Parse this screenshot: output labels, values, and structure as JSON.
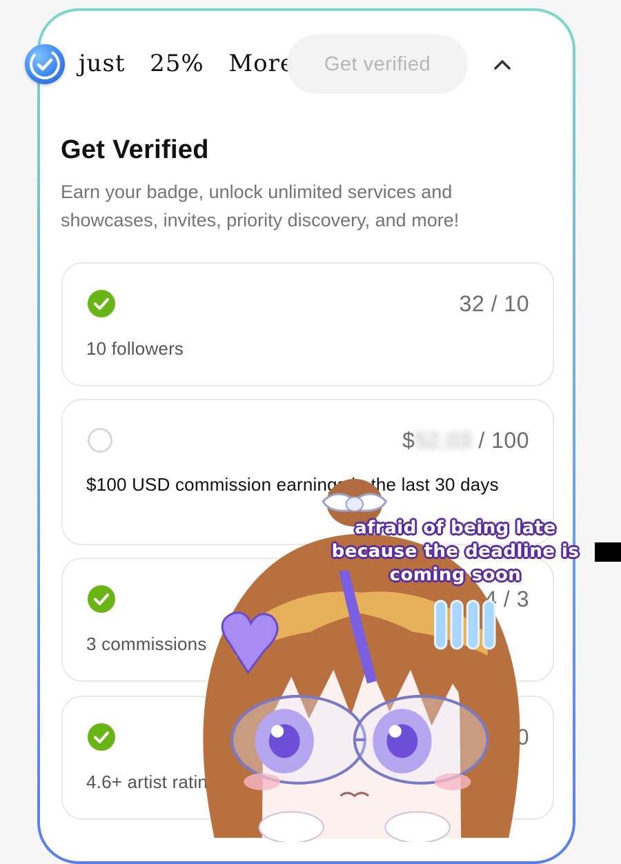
{
  "header": {
    "progress_text": "just  25%  More!",
    "get_verified_button": "Get verified",
    "icons": {
      "verified": "verified-check-badge-icon",
      "collapse": "chevron-up-icon"
    }
  },
  "title": "Get Verified",
  "description": "Earn your badge, unlock unlimited services and showcases, invites, priority discovery, and more!",
  "requirements": [
    {
      "done": true,
      "count": "32 / 10",
      "label": "10 followers"
    },
    {
      "done": false,
      "count_prefix": "$",
      "count_hidden": "52.03",
      "count_suffix": " / 100",
      "label": "$100 USD commission earnings in the last 30 days"
    },
    {
      "done": true,
      "count": "4 / 3",
      "label": "3 commissions"
    },
    {
      "done": true,
      "count": "5.0",
      "label": "4.6+ artist rating"
    }
  ],
  "sticker": {
    "caption_lines": [
      "afraid of being late",
      "because the deadline is",
      "coming soon"
    ]
  },
  "colors": {
    "check_green": "#6ab516",
    "border_gradient_top": "#7cd6c9",
    "border_gradient_bottom": "#5c7ee8",
    "caption_outline": "#5a2ea0"
  }
}
